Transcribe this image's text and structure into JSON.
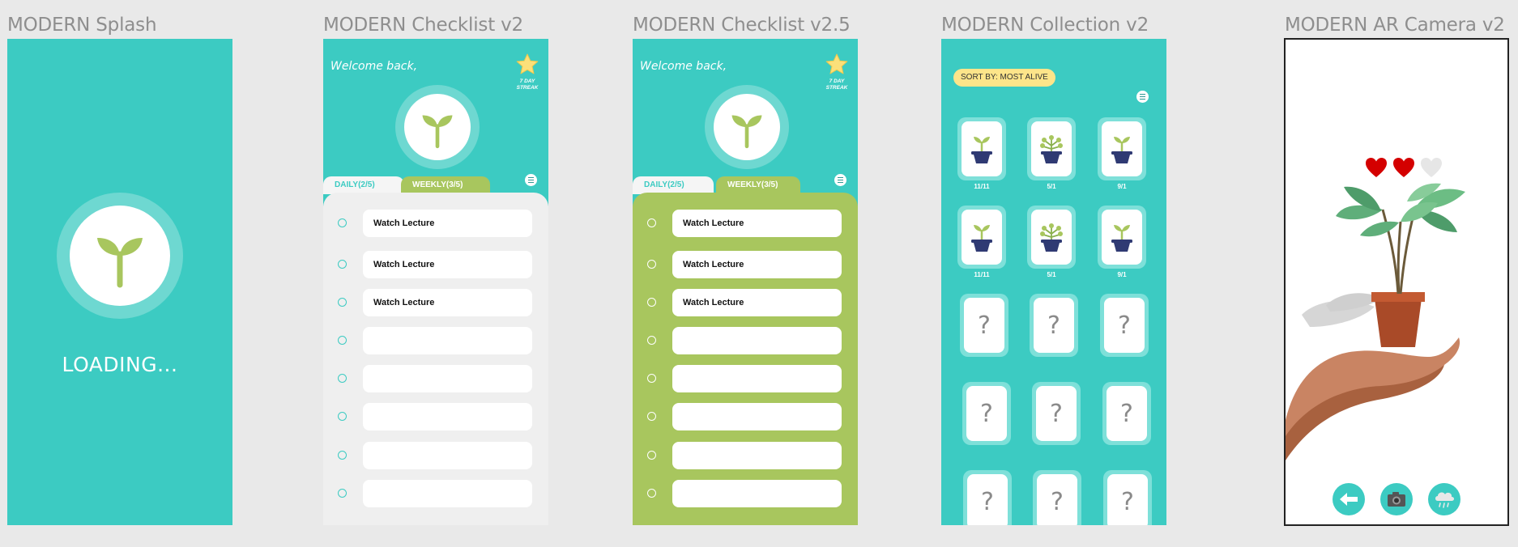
{
  "frames": {
    "splash": {
      "title": "MODERN Splash",
      "loading": "LOADING..."
    },
    "checklist_v2": {
      "title": "MODERN Checklist v2",
      "welcome": "Welcome back,",
      "streak": "7 DAY STREAK",
      "tabs": {
        "daily": "DAILY(2/5)",
        "weekly": "WEEKLY(3/5)"
      },
      "tasks": [
        "Watch Lecture",
        "Watch Lecture",
        "Watch Lecture",
        "",
        "",
        "",
        "",
        ""
      ]
    },
    "checklist_v25": {
      "title": "MODERN Checklist v2.5",
      "welcome": "Welcome back,",
      "streak": "7 DAY STREAK",
      "tabs": {
        "daily": "DAILY(2/5)",
        "weekly": "WEEKLY(3/5)"
      },
      "tasks": [
        "Watch Lecture",
        "Watch Lecture",
        "Watch Lecture",
        "",
        "",
        "",
        "",
        ""
      ]
    },
    "collection_v2": {
      "title": "MODERN Collection v2",
      "sort_label": "SORT BY: MOST ALIVE",
      "plants": [
        {
          "label": "11/11",
          "icon": "sprout-pot-icon"
        },
        {
          "label": "5/1",
          "icon": "bush-pot-icon"
        },
        {
          "label": "9/1",
          "icon": "sprout-pot-icon"
        },
        {
          "label": "11/11",
          "icon": "sprout-pot-icon"
        },
        {
          "label": "5/1",
          "icon": "bush-pot-icon"
        },
        {
          "label": "9/1",
          "icon": "sprout-pot-icon"
        }
      ],
      "locked_mark": "?"
    },
    "ar_camera_v2": {
      "title": "MODERN AR Camera v2",
      "hearts": [
        "full",
        "full",
        "empty"
      ],
      "buttons": [
        "back-arrow-icon",
        "camera-icon",
        "rain-cloud-icon"
      ]
    }
  },
  "colors": {
    "teal": "#3ccbc2",
    "green": "#a8c65e",
    "light_panel": "#efefef",
    "heart": "#d40000",
    "pot": "#2f3a73",
    "sort_pill": "#fde58a"
  }
}
